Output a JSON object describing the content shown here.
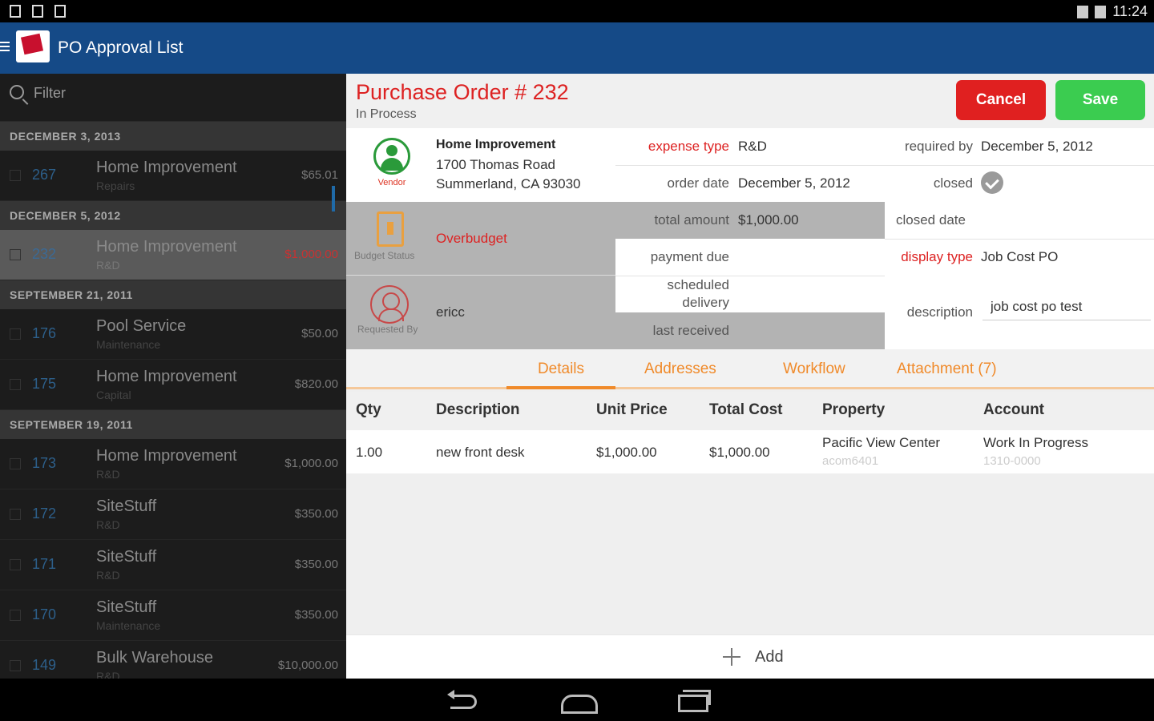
{
  "status_bar": {
    "time": "11:24"
  },
  "app": {
    "title": "PO Approval List"
  },
  "filter": {
    "placeholder": "Filter"
  },
  "po_list": {
    "groups": [
      {
        "date": "DECEMBER 3, 2013",
        "items": [
          {
            "number": "267",
            "name": "Home Improvement",
            "category": "Repairs",
            "amount": "$65.01"
          }
        ]
      },
      {
        "date": "DECEMBER 5, 2012",
        "items": [
          {
            "number": "232",
            "name": "Home Improvement",
            "category": "R&D",
            "amount": "$1,000.00",
            "selected": true
          }
        ]
      },
      {
        "date": "SEPTEMBER 21, 2011",
        "items": [
          {
            "number": "176",
            "name": "Pool Service",
            "category": "Maintenance",
            "amount": "$50.00"
          },
          {
            "number": "175",
            "name": "Home Improvement",
            "category": "Capital",
            "amount": "$820.00"
          }
        ]
      },
      {
        "date": "SEPTEMBER 19, 2011",
        "items": [
          {
            "number": "173",
            "name": "Home Improvement",
            "category": "R&D",
            "amount": "$1,000.00"
          },
          {
            "number": "172",
            "name": "SiteStuff",
            "category": "R&D",
            "amount": "$350.00"
          },
          {
            "number": "171",
            "name": "SiteStuff",
            "category": "R&D",
            "amount": "$350.00"
          },
          {
            "number": "170",
            "name": "SiteStuff",
            "category": "Maintenance",
            "amount": "$350.00"
          },
          {
            "number": "149",
            "name": "Bulk Warehouse",
            "category": "R&D",
            "amount": "$10,000.00"
          }
        ]
      }
    ]
  },
  "detail": {
    "title": "Purchase Order # 232",
    "status": "In Process",
    "cancel_label": "Cancel",
    "save_label": "Save",
    "vendor": {
      "label": "Vendor",
      "name": "Home Improvement",
      "address1": "1700 Thomas Road",
      "address2": "Summerland, CA 93030"
    },
    "budget": {
      "label": "Budget Status",
      "value": "Overbudget"
    },
    "requested": {
      "label": "Requested By",
      "value": "ericc"
    },
    "fields": {
      "expense_type_label": "expense type",
      "expense_type": "R&D",
      "required_by_label": "required by",
      "required_by": "December 5, 2012",
      "order_date_label": "order date",
      "order_date": "December 5, 2012",
      "closed_label": "closed",
      "total_amount_label": "total amount",
      "total_amount": "$1,000.00",
      "closed_date_label": "closed date",
      "payment_due_label": "payment due",
      "display_type_label": "display type",
      "display_type": "Job Cost PO",
      "scheduled_delivery_label_1": "scheduled",
      "scheduled_delivery_label_2": "delivery",
      "description_label": "description",
      "description": "job cost po test",
      "last_received_label": "last received"
    },
    "tabs": [
      "Details",
      "Addresses",
      "Workflow",
      "Attachment (7)"
    ],
    "table": {
      "headers": [
        "Qty",
        "Description",
        "Unit Price",
        "Total Cost",
        "Property",
        "Account"
      ],
      "rows": [
        {
          "qty": "1.00",
          "description": "new front desk",
          "unit_price": "$1,000.00",
          "total_cost": "$1,000.00",
          "property": "Pacific View Center",
          "property_code": "acom6401",
          "account": "Work In Progress",
          "account_code": "1310-0000"
        }
      ]
    },
    "add_label": "Add"
  },
  "colors": {
    "action_bar": "#154a87",
    "accent_red": "#dd2222",
    "save_green": "#3bcc50",
    "tab_orange": "#f08a2a"
  }
}
